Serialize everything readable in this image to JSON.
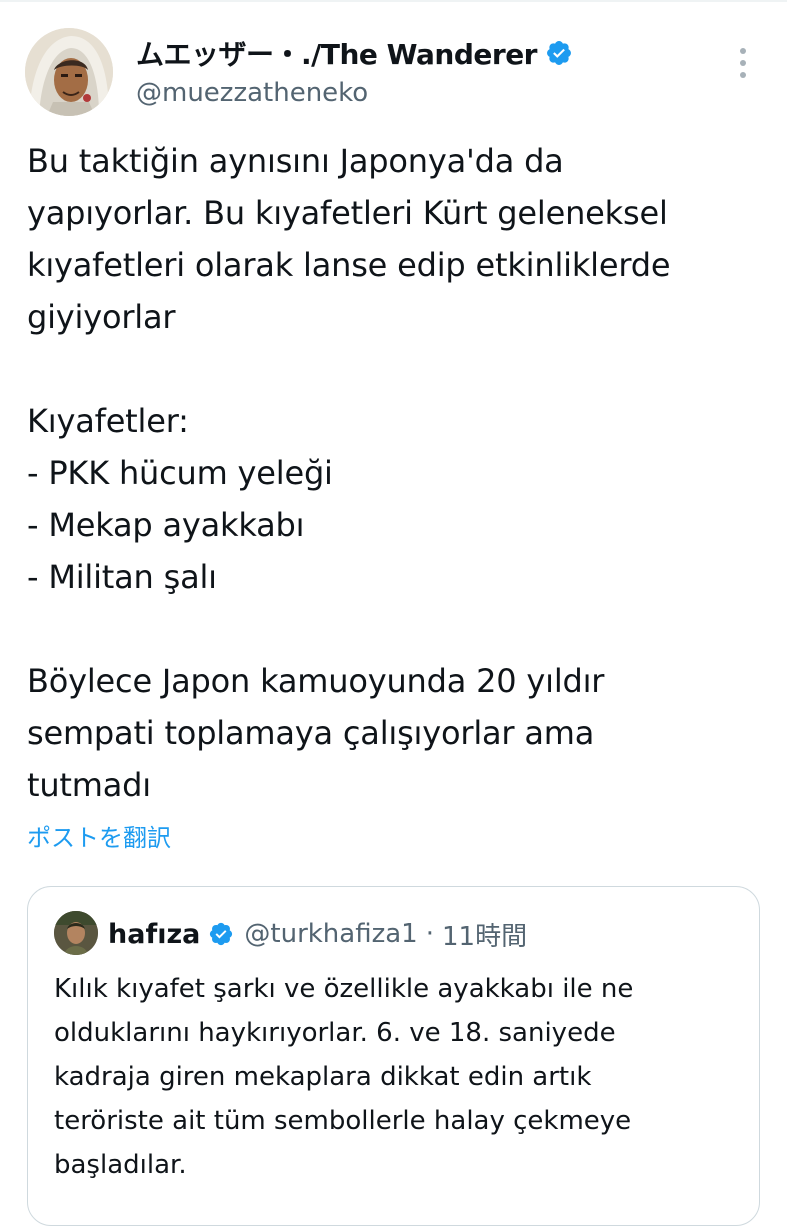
{
  "author": {
    "display_name": "ムエッザー・./The Wanderer",
    "handle": "@muezzatheneko",
    "verified": true,
    "avatar_icon": "avatar-hooded-character"
  },
  "tweet": {
    "text": "Bu taktiğin aynısını Japonya'da da\nyapıyorlar. Bu kıyafetleri Kürt geleneksel\nkıyafetleri olarak lanse edip etkinliklerde\ngiyiyorlar\n\nKıyafetler:\n- PKK hücum yeleği\n- Mekap ayakkabı\n- Militan şalı\n\nBöylece Japon kamuoyunda 20 yıldır\nsempati toplamaya çalışıyorlar ama\ntutmadı",
    "translate_label": "ポストを翻訳"
  },
  "quote": {
    "display_name": "hafıza",
    "handle": "@turkhafiza1",
    "separator": "·",
    "time": "11時間",
    "verified": true,
    "text": "Kılık kıyafet şarkı ve özellikle ayakkabı ile ne\nolduklarını haykırıyorlar. 6. ve 18. saniyede\nkadraja giren mekaplara dikkat edin artık\nteröriste ait tüm sembollerle halay çekmeye\nbaşladılar."
  },
  "colors": {
    "text": "#0f1419",
    "secondary": "#536471",
    "link": "#1d9bf0",
    "verified_badge": "#1d9bf0",
    "border": "#cfd9de"
  }
}
